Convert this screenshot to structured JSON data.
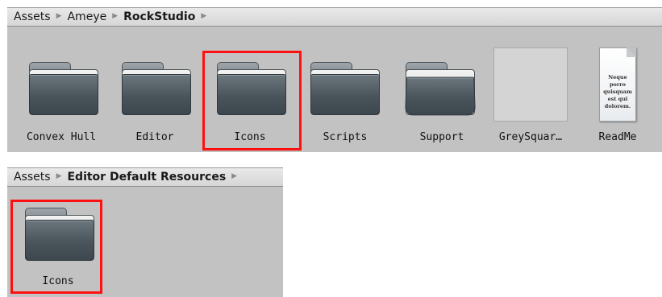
{
  "panel1": {
    "breadcrumb": [
      "Assets",
      "Ameye",
      "RockStudio"
    ],
    "separator": "▶",
    "items": [
      {
        "label": "Convex Hull",
        "kind": "folder"
      },
      {
        "label": "Editor",
        "kind": "folder"
      },
      {
        "label": "Icons",
        "kind": "folder"
      },
      {
        "label": "Scripts",
        "kind": "folder"
      },
      {
        "label": "Support",
        "kind": "folder-open"
      },
      {
        "label": "GreySquar…",
        "kind": "texture"
      },
      {
        "label": "ReadMe",
        "kind": "text-asset",
        "preview_text": "Neque porro quisquam est qui dolorem."
      }
    ]
  },
  "panel2": {
    "breadcrumb": [
      "Assets",
      "Editor Default Resources"
    ],
    "separator": "▶",
    "items": [
      {
        "label": "Icons",
        "kind": "folder"
      }
    ]
  },
  "colors": {
    "panel_bg": "#c2c2c2",
    "highlight": "#ff1010",
    "folder_dark": "#4a545b"
  }
}
